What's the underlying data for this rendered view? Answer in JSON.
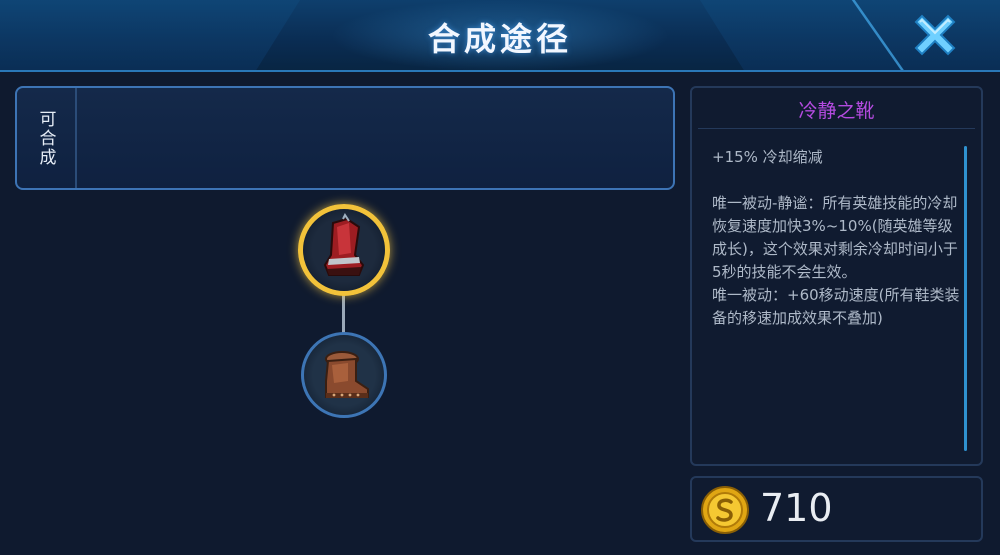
{
  "header": {
    "title": "合成途径",
    "close_icon": "close-x-icon"
  },
  "synthesis": {
    "label": "可合成"
  },
  "tree": {
    "top_item_icon": "red-boots-icon",
    "bottom_item_icon": "brown-boots-icon"
  },
  "detail": {
    "name": "冷静之靴",
    "name_color": "#b44be0",
    "stat": "+15% 冷却缩减",
    "passive1": "唯一被动-静谧：所有英雄技能的冷却恢复速度加快3%~10%(随英雄等级成长)，这个效果对剩余冷却时间小于5秒的技能不会生效。",
    "passive2": "唯一被动：+60移动速度(所有鞋类装备的移速加成效果不叠加)"
  },
  "price": {
    "value": "710",
    "icon": "gold-coin-icon"
  }
}
